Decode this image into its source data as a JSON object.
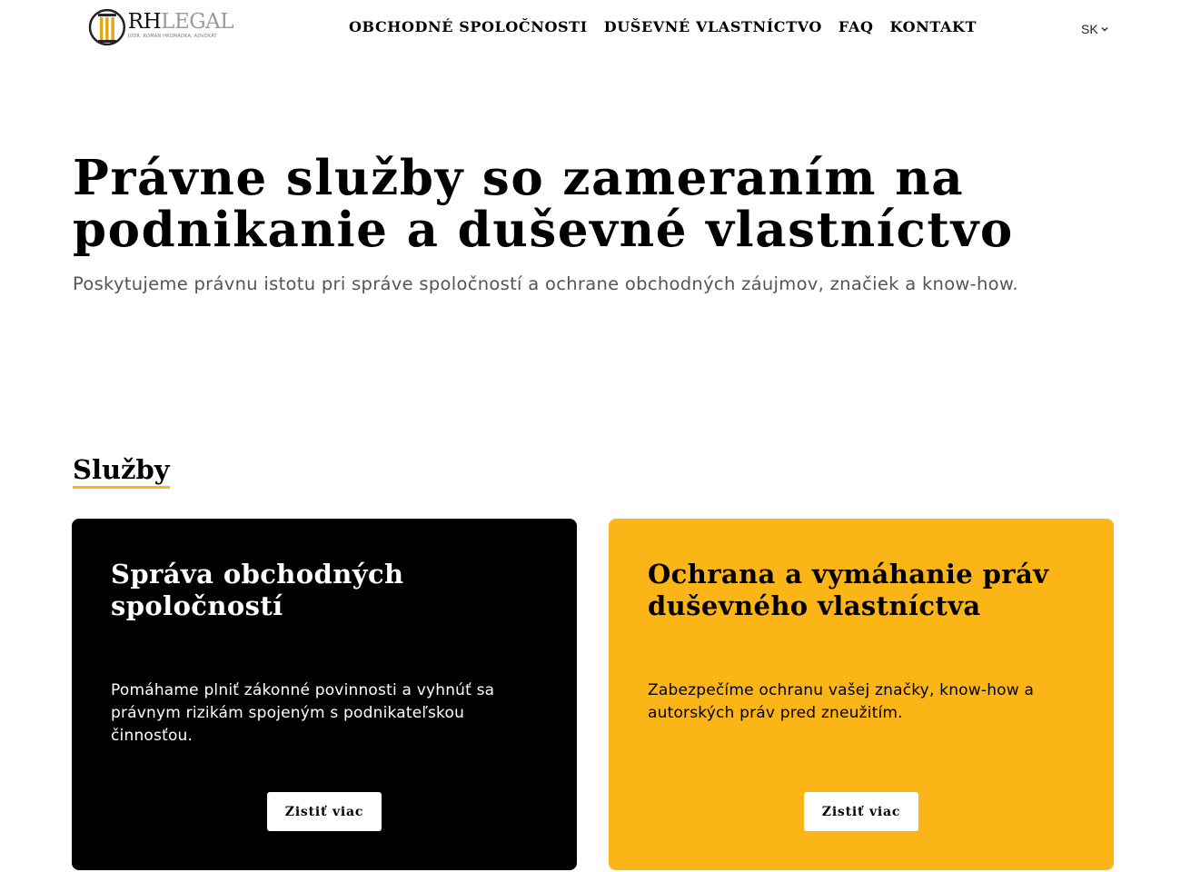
{
  "header": {
    "logo": {
      "brand_rh": "RH",
      "brand_legal": "LEGAL",
      "tagline": "JUDR. ROMAN HROMÁDKA, ADVOKÁT",
      "icon": "column-pillar-icon"
    },
    "nav": [
      {
        "label": "OBCHODNÉ SPOLOČNOSTI"
      },
      {
        "label": "DUŠEVNÉ VLASTNÍCTVO"
      },
      {
        "label": "FAQ"
      },
      {
        "label": "KONTAKT"
      }
    ],
    "language": {
      "selected": "SK",
      "icon": "chevron-down-icon"
    }
  },
  "hero": {
    "title": "Právne služby so zameraním na podnikanie a duševné vlastníctvo",
    "subtitle": "Poskytujeme právnu istotu pri správe spoločností a ochrane obchodných záujmov, značiek a know-how."
  },
  "services": {
    "heading": "Služby",
    "cards": [
      {
        "title": "Správa obchodných spoločností",
        "text": "Pomáhame plniť zákonné povinnosti a vyhnúť sa právnym rizikám spojeným s podnikateľskou činnosťou.",
        "button": "Zistiť viac",
        "background": "#000000"
      },
      {
        "title": "Ochrana a vymáhanie práv duševného vlastníctva",
        "text": "Zabezpečíme ochranu vašej značky, know-how a autorských práv pred zneužitím.",
        "button": "Zistiť viac",
        "background": "#fbb516"
      }
    ]
  },
  "colors": {
    "accent": "#fbb516",
    "text": "#000000",
    "muted": "#555555"
  }
}
